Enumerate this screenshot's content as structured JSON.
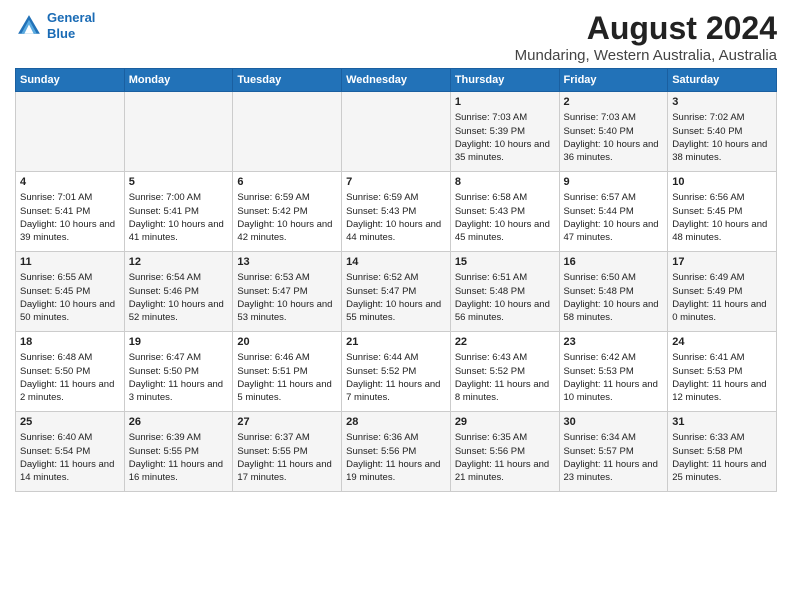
{
  "header": {
    "logo_line1": "General",
    "logo_line2": "Blue",
    "main_title": "August 2024",
    "subtitle": "Mundaring, Western Australia, Australia"
  },
  "days_of_week": [
    "Sunday",
    "Monday",
    "Tuesday",
    "Wednesday",
    "Thursday",
    "Friday",
    "Saturday"
  ],
  "weeks": [
    [
      {
        "day": "",
        "sunrise": "",
        "sunset": "",
        "daylight": ""
      },
      {
        "day": "",
        "sunrise": "",
        "sunset": "",
        "daylight": ""
      },
      {
        "day": "",
        "sunrise": "",
        "sunset": "",
        "daylight": ""
      },
      {
        "day": "",
        "sunrise": "",
        "sunset": "",
        "daylight": ""
      },
      {
        "day": "1",
        "sunrise": "Sunrise: 7:03 AM",
        "sunset": "Sunset: 5:39 PM",
        "daylight": "Daylight: 10 hours and 35 minutes."
      },
      {
        "day": "2",
        "sunrise": "Sunrise: 7:03 AM",
        "sunset": "Sunset: 5:40 PM",
        "daylight": "Daylight: 10 hours and 36 minutes."
      },
      {
        "day": "3",
        "sunrise": "Sunrise: 7:02 AM",
        "sunset": "Sunset: 5:40 PM",
        "daylight": "Daylight: 10 hours and 38 minutes."
      }
    ],
    [
      {
        "day": "4",
        "sunrise": "Sunrise: 7:01 AM",
        "sunset": "Sunset: 5:41 PM",
        "daylight": "Daylight: 10 hours and 39 minutes."
      },
      {
        "day": "5",
        "sunrise": "Sunrise: 7:00 AM",
        "sunset": "Sunset: 5:41 PM",
        "daylight": "Daylight: 10 hours and 41 minutes."
      },
      {
        "day": "6",
        "sunrise": "Sunrise: 6:59 AM",
        "sunset": "Sunset: 5:42 PM",
        "daylight": "Daylight: 10 hours and 42 minutes."
      },
      {
        "day": "7",
        "sunrise": "Sunrise: 6:59 AM",
        "sunset": "Sunset: 5:43 PM",
        "daylight": "Daylight: 10 hours and 44 minutes."
      },
      {
        "day": "8",
        "sunrise": "Sunrise: 6:58 AM",
        "sunset": "Sunset: 5:43 PM",
        "daylight": "Daylight: 10 hours and 45 minutes."
      },
      {
        "day": "9",
        "sunrise": "Sunrise: 6:57 AM",
        "sunset": "Sunset: 5:44 PM",
        "daylight": "Daylight: 10 hours and 47 minutes."
      },
      {
        "day": "10",
        "sunrise": "Sunrise: 6:56 AM",
        "sunset": "Sunset: 5:45 PM",
        "daylight": "Daylight: 10 hours and 48 minutes."
      }
    ],
    [
      {
        "day": "11",
        "sunrise": "Sunrise: 6:55 AM",
        "sunset": "Sunset: 5:45 PM",
        "daylight": "Daylight: 10 hours and 50 minutes."
      },
      {
        "day": "12",
        "sunrise": "Sunrise: 6:54 AM",
        "sunset": "Sunset: 5:46 PM",
        "daylight": "Daylight: 10 hours and 52 minutes."
      },
      {
        "day": "13",
        "sunrise": "Sunrise: 6:53 AM",
        "sunset": "Sunset: 5:47 PM",
        "daylight": "Daylight: 10 hours and 53 minutes."
      },
      {
        "day": "14",
        "sunrise": "Sunrise: 6:52 AM",
        "sunset": "Sunset: 5:47 PM",
        "daylight": "Daylight: 10 hours and 55 minutes."
      },
      {
        "day": "15",
        "sunrise": "Sunrise: 6:51 AM",
        "sunset": "Sunset: 5:48 PM",
        "daylight": "Daylight: 10 hours and 56 minutes."
      },
      {
        "day": "16",
        "sunrise": "Sunrise: 6:50 AM",
        "sunset": "Sunset: 5:48 PM",
        "daylight": "Daylight: 10 hours and 58 minutes."
      },
      {
        "day": "17",
        "sunrise": "Sunrise: 6:49 AM",
        "sunset": "Sunset: 5:49 PM",
        "daylight": "Daylight: 11 hours and 0 minutes."
      }
    ],
    [
      {
        "day": "18",
        "sunrise": "Sunrise: 6:48 AM",
        "sunset": "Sunset: 5:50 PM",
        "daylight": "Daylight: 11 hours and 2 minutes."
      },
      {
        "day": "19",
        "sunrise": "Sunrise: 6:47 AM",
        "sunset": "Sunset: 5:50 PM",
        "daylight": "Daylight: 11 hours and 3 minutes."
      },
      {
        "day": "20",
        "sunrise": "Sunrise: 6:46 AM",
        "sunset": "Sunset: 5:51 PM",
        "daylight": "Daylight: 11 hours and 5 minutes."
      },
      {
        "day": "21",
        "sunrise": "Sunrise: 6:44 AM",
        "sunset": "Sunset: 5:52 PM",
        "daylight": "Daylight: 11 hours and 7 minutes."
      },
      {
        "day": "22",
        "sunrise": "Sunrise: 6:43 AM",
        "sunset": "Sunset: 5:52 PM",
        "daylight": "Daylight: 11 hours and 8 minutes."
      },
      {
        "day": "23",
        "sunrise": "Sunrise: 6:42 AM",
        "sunset": "Sunset: 5:53 PM",
        "daylight": "Daylight: 11 hours and 10 minutes."
      },
      {
        "day": "24",
        "sunrise": "Sunrise: 6:41 AM",
        "sunset": "Sunset: 5:53 PM",
        "daylight": "Daylight: 11 hours and 12 minutes."
      }
    ],
    [
      {
        "day": "25",
        "sunrise": "Sunrise: 6:40 AM",
        "sunset": "Sunset: 5:54 PM",
        "daylight": "Daylight: 11 hours and 14 minutes."
      },
      {
        "day": "26",
        "sunrise": "Sunrise: 6:39 AM",
        "sunset": "Sunset: 5:55 PM",
        "daylight": "Daylight: 11 hours and 16 minutes."
      },
      {
        "day": "27",
        "sunrise": "Sunrise: 6:37 AM",
        "sunset": "Sunset: 5:55 PM",
        "daylight": "Daylight: 11 hours and 17 minutes."
      },
      {
        "day": "28",
        "sunrise": "Sunrise: 6:36 AM",
        "sunset": "Sunset: 5:56 PM",
        "daylight": "Daylight: 11 hours and 19 minutes."
      },
      {
        "day": "29",
        "sunrise": "Sunrise: 6:35 AM",
        "sunset": "Sunset: 5:56 PM",
        "daylight": "Daylight: 11 hours and 21 minutes."
      },
      {
        "day": "30",
        "sunrise": "Sunrise: 6:34 AM",
        "sunset": "Sunset: 5:57 PM",
        "daylight": "Daylight: 11 hours and 23 minutes."
      },
      {
        "day": "31",
        "sunrise": "Sunrise: 6:33 AM",
        "sunset": "Sunset: 5:58 PM",
        "daylight": "Daylight: 11 hours and 25 minutes."
      }
    ]
  ]
}
